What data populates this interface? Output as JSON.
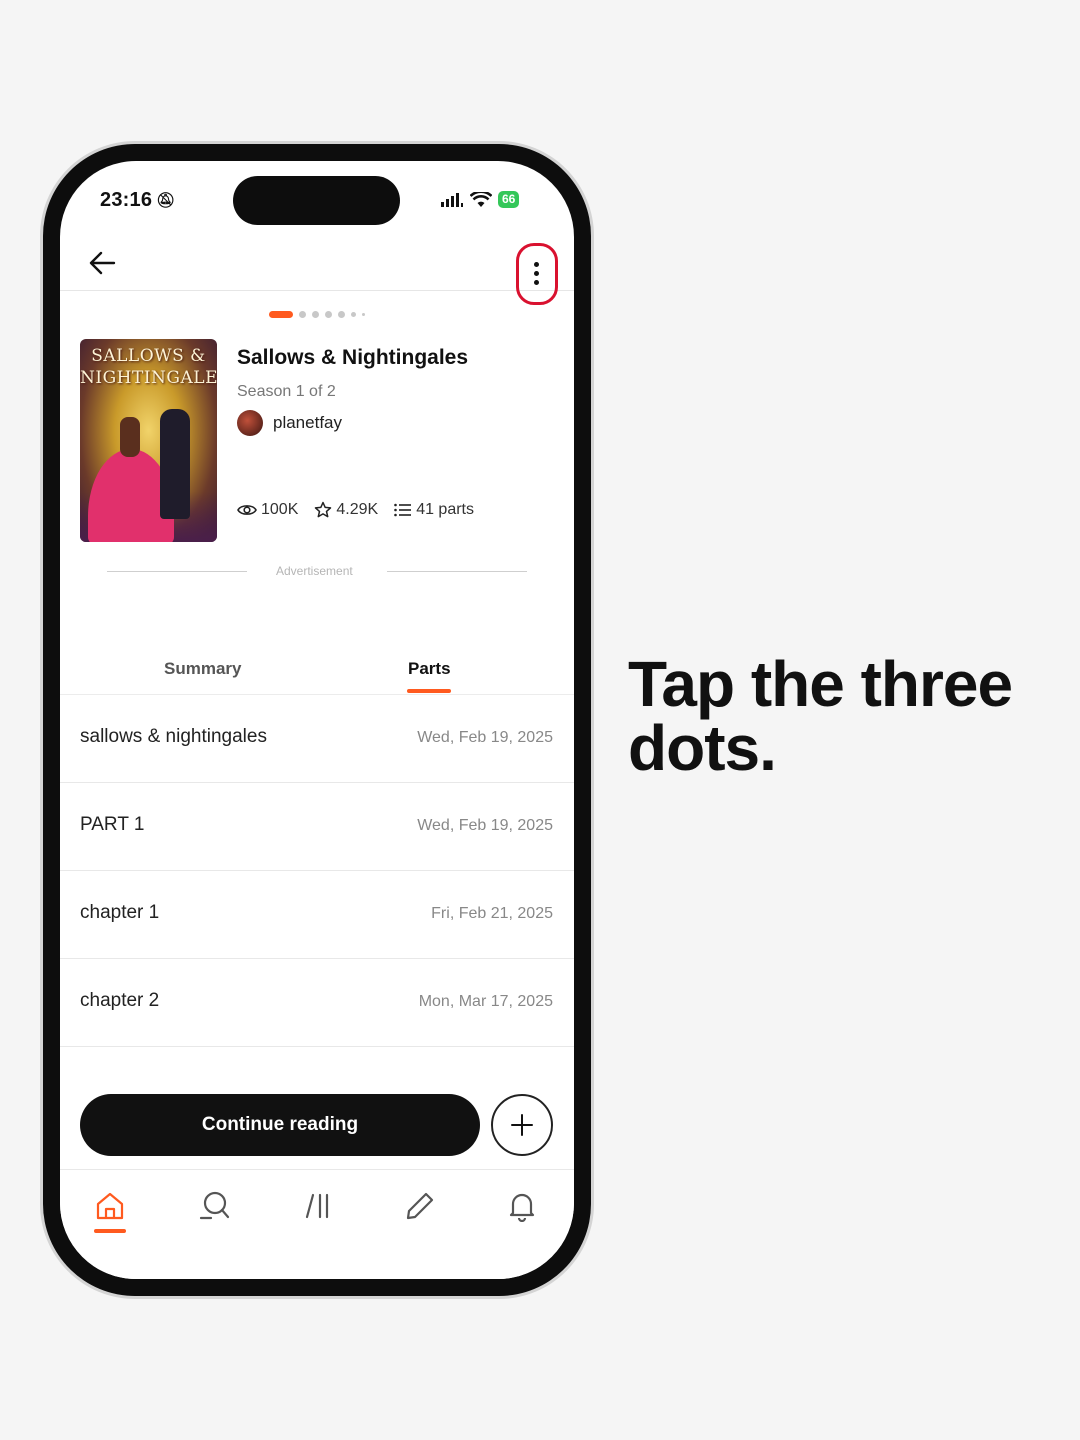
{
  "status_bar": {
    "time": "23:16",
    "battery": "66"
  },
  "book": {
    "cover_title": "SALLOWS & NIGHTINGALES",
    "title": "Sallows & Nightingales",
    "season": "Season 1 of 2",
    "author": "planetfay",
    "reads": "100K",
    "votes": "4.29K",
    "parts_count": "41 parts"
  },
  "ad_label": "Advertisement",
  "tabs": [
    {
      "label": "Summary",
      "active": false
    },
    {
      "label": "Parts",
      "active": true
    }
  ],
  "parts": [
    {
      "title": "sallows & nightingales",
      "date": "Wed, Feb 19, 2025"
    },
    {
      "title": "PART 1",
      "date": "Wed, Feb 19, 2025"
    },
    {
      "title": "chapter 1",
      "date": "Fri, Feb 21, 2025"
    },
    {
      "title": "chapter 2",
      "date": "Mon, Mar 17, 2025"
    }
  ],
  "continue_label": "Continue reading",
  "bottom_nav": [
    "home-icon",
    "search-icon",
    "library-icon",
    "write-icon",
    "notifications-icon"
  ],
  "instruction": "Tap the three dots.",
  "colors": {
    "accent": "#ff5a1f",
    "highlight": "#d9112f",
    "battery": "#34c759"
  }
}
